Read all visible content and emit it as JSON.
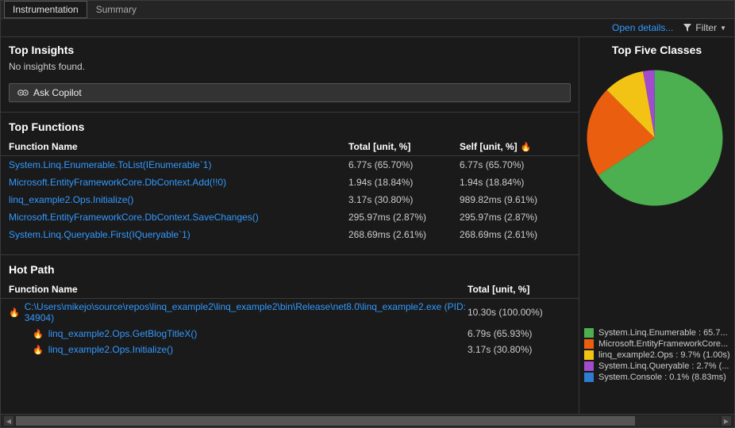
{
  "tabs": {
    "instrumentation": "Instrumentation",
    "summary": "Summary"
  },
  "toolbar": {
    "open_details": "Open details...",
    "filter": "Filter"
  },
  "insights": {
    "title": "Top Insights",
    "none": "No insights found.",
    "copilot": "Ask Copilot"
  },
  "top_functions": {
    "title": "Top Functions",
    "cols": {
      "fn": "Function Name",
      "total": "Total [unit, %]",
      "self": "Self [unit, %]"
    },
    "rows": [
      {
        "fn": "System.Linq.Enumerable.ToList(IEnumerable`1)",
        "total": "6.77s (65.70%)",
        "self": "6.77s (65.70%)"
      },
      {
        "fn": "Microsoft.EntityFrameworkCore.DbContext.Add(!!0)",
        "total": "1.94s (18.84%)",
        "self": "1.94s (18.84%)"
      },
      {
        "fn": "linq_example2.Ops.Initialize()",
        "total": "3.17s (30.80%)",
        "self": "989.82ms (9.61%)"
      },
      {
        "fn": "Microsoft.EntityFrameworkCore.DbContext.SaveChanges()",
        "total": "295.97ms (2.87%)",
        "self": "295.97ms (2.87%)"
      },
      {
        "fn": "System.Linq.Queryable.First(IQueryable`1)",
        "total": "268.69ms (2.61%)",
        "self": "268.69ms (2.61%)"
      }
    ]
  },
  "hot_path": {
    "title": "Hot Path",
    "cols": {
      "fn": "Function Name",
      "total": "Total [unit, %]"
    },
    "rows": [
      {
        "fn": "C:\\Users\\mikejo\\source\\repos\\linq_example2\\linq_example2\\bin\\Release\\net8.0\\linq_example2.exe (PID: 34904)",
        "total": "10.30s (100.00%)",
        "indent": 0
      },
      {
        "fn": "linq_example2.Ops.GetBlogTitleX()",
        "total": "6.79s (65.93%)",
        "indent": 1
      },
      {
        "fn": "linq_example2.Ops.Initialize()",
        "total": "3.17s (30.80%)",
        "indent": 2
      }
    ]
  },
  "chart_data": {
    "type": "pie",
    "title": "Top Five Classes",
    "series": [
      {
        "name": "System.Linq.Enumerable",
        "value": 65.7,
        "label": "System.Linq.Enumerable : 65.7...",
        "color": "#4caf50"
      },
      {
        "name": "Microsoft.EntityFrameworkCore",
        "value": 21.8,
        "label": "Microsoft.EntityFrameworkCore...",
        "color": "#e95f0f"
      },
      {
        "name": "linq_example2.Ops",
        "value": 9.7,
        "label": "linq_example2.Ops : 9.7% (1.00s)",
        "color": "#f2c314"
      },
      {
        "name": "System.Linq.Queryable",
        "value": 2.7,
        "label": "System.Linq.Queryable : 2.7% (...",
        "color": "#a24ccd"
      },
      {
        "name": "System.Console",
        "value": 0.1,
        "label": "System.Console : 0.1% (8.83ms)",
        "color": "#2d7cd1"
      }
    ]
  }
}
